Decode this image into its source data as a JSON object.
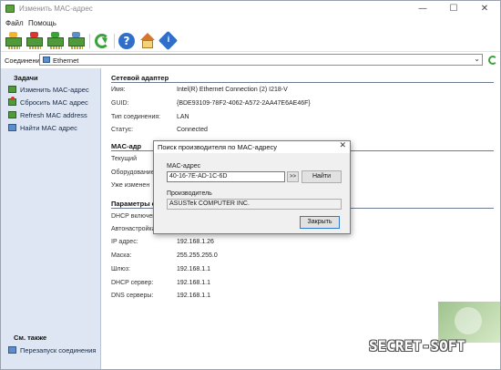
{
  "window": {
    "title": "Изменить MAC-адрес",
    "controls": {
      "minimize": "—",
      "maximize": "☐",
      "close": "✕"
    }
  },
  "menu": {
    "items": [
      "Файл",
      "Помощь"
    ]
  },
  "toolbar": {
    "buttons": [
      "nic-change-icon",
      "nic-reset-icon",
      "nic-refresh-icon",
      "nic-find-icon",
      "refresh-icon",
      "help-icon",
      "home-icon",
      "info-icon"
    ],
    "help_glyph": "?",
    "info_glyph": "i"
  },
  "connection": {
    "label": "Соединение:",
    "value": "Ethernet",
    "arrow": "⌄"
  },
  "sidebar": {
    "tasks_header": "Задачи",
    "tasks": [
      {
        "label": "Изменить MAC-адрес",
        "icon": "nic-icon"
      },
      {
        "label": "Сбросить MAC адрес",
        "icon": "nic-reset-icon"
      },
      {
        "label": "Refresh MAC address",
        "icon": "nic-refresh-icon"
      },
      {
        "label": "Найти MAC адрес",
        "icon": "nic-find-icon"
      }
    ],
    "see_also_header": "См. также",
    "see_also": [
      {
        "label": "Перезапуск соединения",
        "icon": "network-icon"
      }
    ]
  },
  "adapter": {
    "title": "Сетевой адаптер",
    "rows": [
      {
        "label": "Имя:",
        "value": "Intel(R) Ethernet Connection (2) I218-V"
      },
      {
        "label": "GUID:",
        "value": "{BDE93109-78F2-4062-A572-2AA47E6AE46F}"
      },
      {
        "label": "Тип соединения:",
        "value": "LAN"
      },
      {
        "label": "Статус:",
        "value": "Connected"
      }
    ]
  },
  "mac": {
    "title": "MAC-адр",
    "rows": [
      {
        "label": "Текущий"
      },
      {
        "label": "Оборудование"
      },
      {
        "label": "Уже изменен"
      }
    ]
  },
  "params": {
    "title": "Параметры с",
    "rows": [
      {
        "label": "DHCP включен",
        "value": ""
      },
      {
        "label": "Автонастройка",
        "value": ""
      },
      {
        "label": "IP адрес:",
        "value": "192.168.1.26"
      },
      {
        "label": "Маска:",
        "value": "255.255.255.0"
      },
      {
        "label": "Шлюз:",
        "value": "192.168.1.1"
      },
      {
        "label": "DHCP сервер:",
        "value": "192.168.1.1"
      },
      {
        "label": "DNS серверы:",
        "value": "192.168.1.1"
      }
    ]
  },
  "dialog": {
    "title": "Поиск производителя по MAC-адресу",
    "close": "✕",
    "mac_label": "MAC-адрес",
    "mac_value": "40-16-7E-AD-1C-6D",
    "expand_button": ">>",
    "find_button": "Найти",
    "vendor_label": "Производитель",
    "vendor_value": "ASUSTek COMPUTER INC.",
    "close_button": "Закрыть"
  },
  "watermark": {
    "text": "SECRET-SOFT"
  }
}
